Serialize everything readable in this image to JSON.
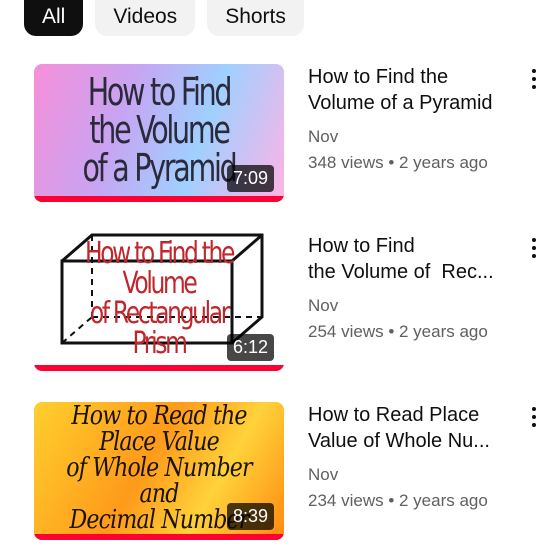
{
  "chips": [
    {
      "label": "All",
      "active": true
    },
    {
      "label": "Videos",
      "active": false
    },
    {
      "label": "Shorts",
      "active": false
    }
  ],
  "videos": [
    {
      "thumb_lines": [
        "How to Find the Volume",
        "of a Pyramid"
      ],
      "duration": "7:09",
      "title_line1": "How to Find the",
      "title_line2": "Volume of a Pyramid",
      "channel": "Nov",
      "stats": "348 views • 2 years ago",
      "watched_fraction": 1.0
    },
    {
      "thumb_lines": [
        "How to Find the Volume",
        "of Rectangular Prism"
      ],
      "duration": "6:12",
      "title_line1": "How to Find",
      "title_line2": "the Volume of  Rec...",
      "channel": "Nov",
      "stats": "254 views • 2 years ago",
      "watched_fraction": 1.0
    },
    {
      "thumb_lines": [
        "How to Read the Place Value",
        "of Whole Number and",
        "Decimal Number"
      ],
      "duration": "8:39",
      "title_line1": "How to Read Place",
      "title_line2": "Value of Whole Nu...",
      "channel": "Nov",
      "stats": "234 views • 2 years ago",
      "watched_fraction": 1.0
    }
  ],
  "colors": {
    "progress": "#ff0033",
    "chip_active_bg": "#0f0f0f",
    "meta_text": "#606060"
  },
  "icons": {
    "menu": "more-vert-icon"
  }
}
